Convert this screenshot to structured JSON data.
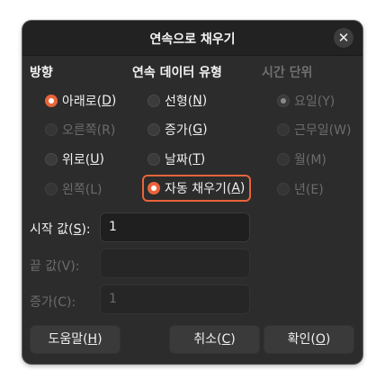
{
  "dialog": {
    "title": "연속으로 채우기",
    "close_glyph": "✕"
  },
  "direction": {
    "heading": "방향",
    "options": [
      {
        "text": "아래로(",
        "key": "D",
        "end": ")",
        "checked": true,
        "enabled": true
      },
      {
        "text": "오른쪽(R)",
        "key": "",
        "end": "",
        "checked": false,
        "enabled": false
      },
      {
        "text": "위로(",
        "key": "U",
        "end": ")",
        "checked": false,
        "enabled": true
      },
      {
        "text": "왼쪽(L)",
        "key": "",
        "end": "",
        "checked": false,
        "enabled": false
      }
    ]
  },
  "series_type": {
    "heading": "연속 데이터 유형",
    "options": [
      {
        "text": "선형(",
        "key": "N",
        "end": ")",
        "checked": false,
        "enabled": true
      },
      {
        "text": "증가(",
        "key": "G",
        "end": ")",
        "checked": false,
        "enabled": true
      },
      {
        "text": "날짜(",
        "key": "T",
        "end": ")",
        "checked": false,
        "enabled": true
      },
      {
        "text": "자동 채우기(",
        "key": "A",
        "end": ")",
        "checked": true,
        "enabled": true
      }
    ]
  },
  "time_unit": {
    "heading": "시간 단위",
    "options": [
      {
        "text": "요일(Y)",
        "checked": true,
        "enabled": false
      },
      {
        "text": "근무일(W)",
        "checked": false,
        "enabled": false
      },
      {
        "text": "월(M)",
        "checked": false,
        "enabled": false
      },
      {
        "text": "년(E)",
        "checked": false,
        "enabled": false
      }
    ]
  },
  "fields": {
    "start": {
      "label": "시작 값(",
      "key": "S",
      "end": "):",
      "value": "1"
    },
    "end": {
      "label": "끝 값(V):",
      "value": ""
    },
    "increment": {
      "label": "증가(C):",
      "value": "1"
    }
  },
  "buttons": {
    "help": {
      "text": "도움말(",
      "key": "H",
      "end": ")"
    },
    "cancel": {
      "text": "취소(",
      "key": "C",
      "end": ")"
    },
    "ok": {
      "text": "확인(",
      "key": "O",
      "end": ")"
    }
  },
  "colors": {
    "accent": "#e9643a",
    "dialog_bg": "#2c2c2c",
    "titlebar_bg": "#222222"
  }
}
